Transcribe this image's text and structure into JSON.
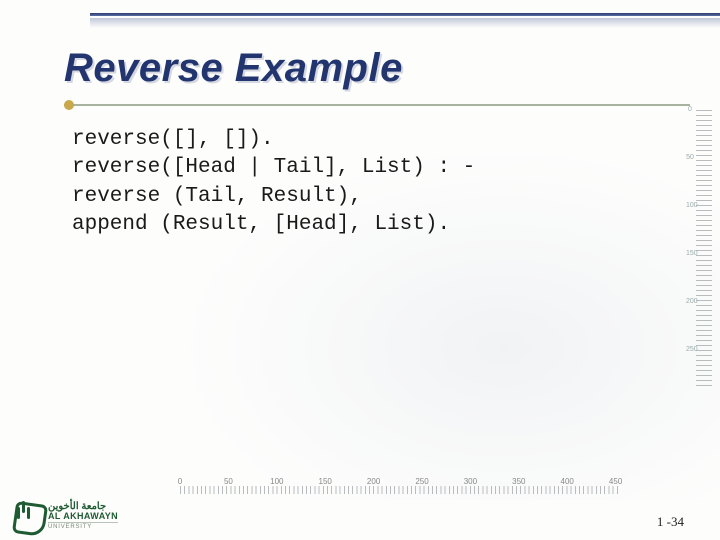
{
  "title": "Reverse Example",
  "code": {
    "line1": "reverse([], []).",
    "line2": "reverse([Head | Tail], List) : -",
    "line3": "reverse (Tail, Result),",
    "line4": "append (Result, [Head], List)."
  },
  "ruler_v": [
    "0",
    "50",
    "100",
    "150",
    "200",
    "250"
  ],
  "ruler_h": [
    "0",
    "50",
    "100",
    "150",
    "200",
    "250",
    "300",
    "350",
    "400",
    "450"
  ],
  "logo": {
    "arabic": "جامعة الأخوين",
    "english": "AL AKHAWAYN",
    "sub": "UNIVERSITY"
  },
  "page_number": "1 -34"
}
